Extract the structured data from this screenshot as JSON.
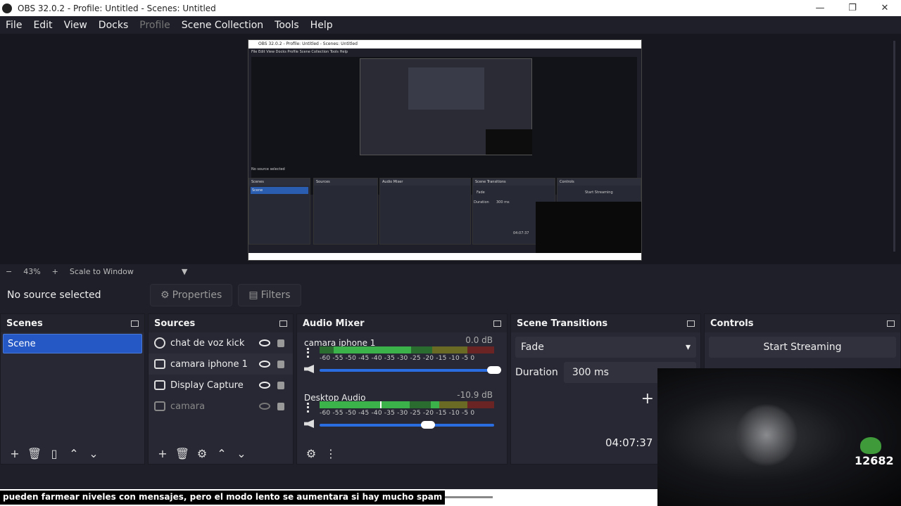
{
  "window": {
    "title": "OBS 32.0.2 - Profile: Untitled - Scenes: Untitled",
    "minimize": "—",
    "maximize": "❐",
    "close": "✕"
  },
  "menu": [
    "File",
    "Edit",
    "View",
    "Docks",
    "Profile",
    "Scene Collection",
    "Tools",
    "Help"
  ],
  "nested_preview": {
    "title": "OBS 32.0.2 - Profile: Untitled - Scenes: Untitled",
    "menu": "File  Edit  View  Docks  Profile  Scene Collection  Tools  Help",
    "no_source": "No source selected",
    "scenes_h": "Scenes",
    "scene": "Scene",
    "sources_h": "Sources",
    "audio_h": "Audio Mixer",
    "trans_h": "Scene Transitions",
    "ctrl_h": "Controls",
    "start": "Start Streaming",
    "fade": "Fade",
    "duration": "Duration",
    "ms": "300 ms",
    "time": "04:07:37"
  },
  "scalebar": {
    "minus": "−",
    "zoom": "43%",
    "plus": "+",
    "mode": "Scale to Window",
    "arrow": "▼"
  },
  "context": {
    "no_source": "No source selected",
    "properties": "Properties",
    "filters": "Filters"
  },
  "scenes": {
    "header": "Scenes",
    "items": [
      "Scene"
    ]
  },
  "sources": {
    "header": "Sources",
    "items": [
      {
        "label": "chat de voz kick"
      },
      {
        "label": "camara iphone 1"
      },
      {
        "label": "Display Capture"
      },
      {
        "label": "camara"
      }
    ]
  },
  "audio": {
    "header": "Audio Mixer",
    "channels": [
      {
        "name": "camara iphone 1",
        "db": "0.0 dB",
        "volume": 1.0
      },
      {
        "name": "Desktop Audio",
        "db": "-10.9 dB",
        "volume": 0.62
      }
    ],
    "ticks": "-60 -55 -50 -45 -40 -35 -30 -25 -20 -15 -10  -5   0"
  },
  "transitions": {
    "header": "Scene Transitions",
    "type": "Fade",
    "duration_label": "Duration",
    "duration": "300 ms",
    "add": "+"
  },
  "controls": {
    "header": "Controls",
    "start_streaming": "Start Streaming"
  },
  "status": {
    "time": "04:07:37"
  },
  "overlay": {
    "count": "12682"
  },
  "subtitle": "pueden farmear niveles con mensajes, pero el modo lento se aumentara si hay mucho spam"
}
